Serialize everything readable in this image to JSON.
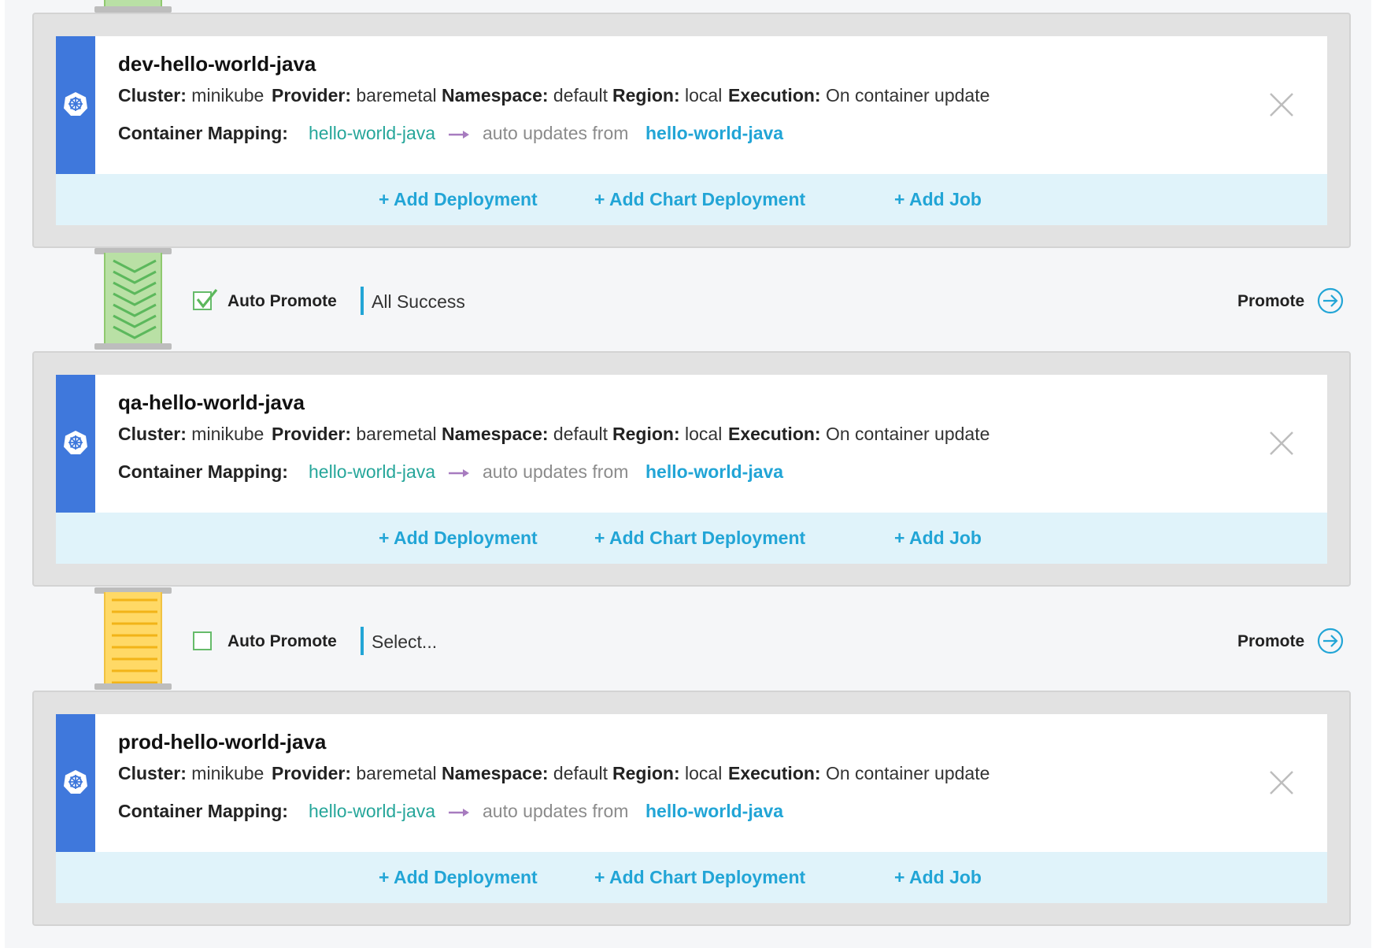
{
  "environments": [
    {
      "name": "dev-hello-world-java",
      "cluster_label": "Cluster:",
      "cluster": "minikube",
      "provider_label": "Provider:",
      "provider": "baremetal",
      "namespace_label": "Namespace:",
      "namespace": "default",
      "region_label": "Region:",
      "region": "local",
      "execution_label": "Execution:",
      "execution": "On container update",
      "mapping_label": "Container Mapping:",
      "mapping_source": "hello-world-java",
      "mapping_auto": "auto updates from",
      "mapping_target": "hello-world-java",
      "actions": {
        "add_deployment": "+ Add Deployment",
        "add_chart_deployment": "+ Add Chart Deployment",
        "add_job": "+ Add Job"
      }
    },
    {
      "name": "qa-hello-world-java",
      "cluster_label": "Cluster:",
      "cluster": "minikube",
      "provider_label": "Provider:",
      "provider": "baremetal",
      "namespace_label": "Namespace:",
      "namespace": "default",
      "region_label": "Region:",
      "region": "local",
      "execution_label": "Execution:",
      "execution": "On container update",
      "mapping_label": "Container Mapping:",
      "mapping_source": "hello-world-java",
      "mapping_auto": "auto updates from",
      "mapping_target": "hello-world-java",
      "actions": {
        "add_deployment": "+ Add Deployment",
        "add_chart_deployment": "+ Add Chart Deployment",
        "add_job": "+ Add Job"
      }
    },
    {
      "name": "prod-hello-world-java",
      "cluster_label": "Cluster:",
      "cluster": "minikube",
      "provider_label": "Provider:",
      "provider": "baremetal",
      "namespace_label": "Namespace:",
      "namespace": "default",
      "region_label": "Region:",
      "region": "local",
      "execution_label": "Execution:",
      "execution": "On container update",
      "mapping_label": "Container Mapping:",
      "mapping_source": "hello-world-java",
      "mapping_auto": "auto updates from",
      "mapping_target": "hello-world-java",
      "actions": {
        "add_deployment": "+ Add Deployment",
        "add_chart_deployment": "+ Add Chart Deployment",
        "add_job": "+ Add Job"
      }
    }
  ],
  "promotions": [
    {
      "auto_promote_label": "Auto Promote",
      "auto_promote_checked": true,
      "condition": "All Success",
      "promote_label": "Promote",
      "status_color": "#b9e0a5"
    },
    {
      "auto_promote_label": "Auto Promote",
      "auto_promote_checked": false,
      "condition": "Select...",
      "promote_label": "Promote",
      "status_color": "#ffd966"
    }
  ],
  "colors": {
    "stripe": "#3f78dc",
    "link": "#22a5d6",
    "mapping_source": "#26a69a",
    "arrow": "#a77bbf",
    "action_bar": "#e0f3fa",
    "checkbox": "#66bb6a"
  },
  "icons": [
    "kubernetes-helm-icon",
    "close-icon",
    "arrow-right-icon",
    "promote-arrow-circle-icon",
    "checkmark-icon"
  ]
}
